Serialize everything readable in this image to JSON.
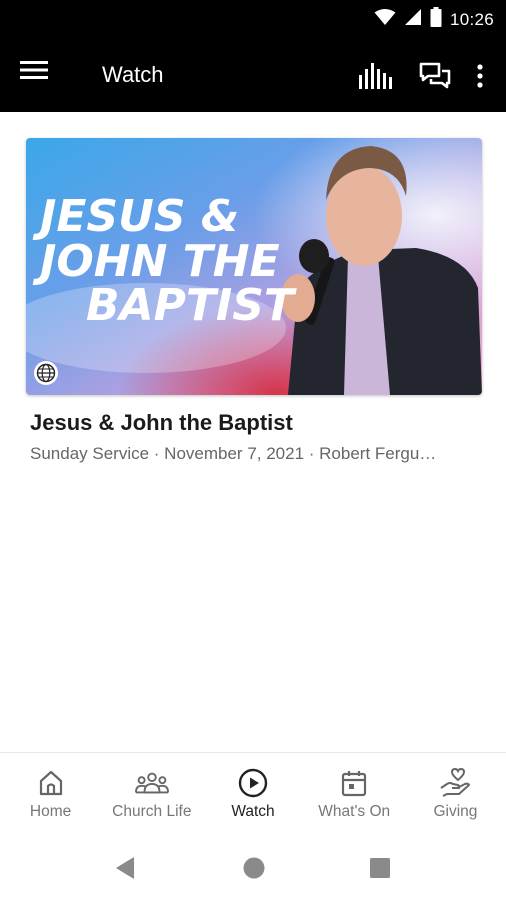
{
  "status_bar": {
    "time": "10:26",
    "icons": [
      "wifi-icon",
      "signal-icon",
      "battery-icon"
    ]
  },
  "app_bar": {
    "title": "Watch",
    "menu_icon": "hamburger-menu-icon",
    "actions": [
      "equalizer-icon",
      "chat-icon",
      "more-vertical-icon"
    ]
  },
  "media_item": {
    "thumbnail": {
      "headline_lines": [
        "JESUS &",
        "JOHN THE",
        "BAPTIST"
      ],
      "badge_icon": "globe-icon"
    },
    "title": "Jesus & John the Baptist",
    "meta": "Sunday Service · November 7, 2021 · Robert Fergu…"
  },
  "bottom_nav": {
    "items": [
      {
        "label": "Home",
        "icon": "home-icon"
      },
      {
        "label": "Church Life",
        "icon": "people-icon"
      },
      {
        "label": "Watch",
        "icon": "play-circle-icon",
        "active": true
      },
      {
        "label": "What's On",
        "icon": "calendar-icon"
      },
      {
        "label": "Giving",
        "icon": "giving-hand-icon"
      }
    ]
  },
  "system_nav": [
    "back-icon",
    "home-circle-icon",
    "recents-icon"
  ],
  "colors": {
    "app_bar": "#000000",
    "active_nav": "#222222",
    "inactive_nav": "#777777"
  }
}
